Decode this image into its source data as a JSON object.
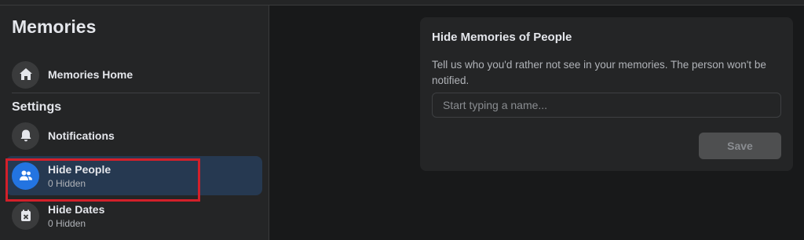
{
  "sidebar": {
    "title": "Memories",
    "home": {
      "label": "Memories Home",
      "icon": "home-icon"
    },
    "settings_label": "Settings",
    "items": [
      {
        "label": "Notifications",
        "sub": "",
        "icon": "bell-icon"
      },
      {
        "label": "Hide People",
        "sub": "0 Hidden",
        "icon": "people-icon",
        "active": true
      },
      {
        "label": "Hide Dates",
        "sub": "0 Hidden",
        "icon": "calendar-x-icon"
      }
    ]
  },
  "main": {
    "card_title": "Hide Memories of People",
    "description": "Tell us who you'd rather not see in your memories. The person won't be notified.",
    "search_placeholder": "Start typing a name...",
    "save_label": "Save"
  },
  "colors": {
    "accent": "#2374e1",
    "active_bg": "#263951",
    "highlight_box": "#d3202a"
  }
}
